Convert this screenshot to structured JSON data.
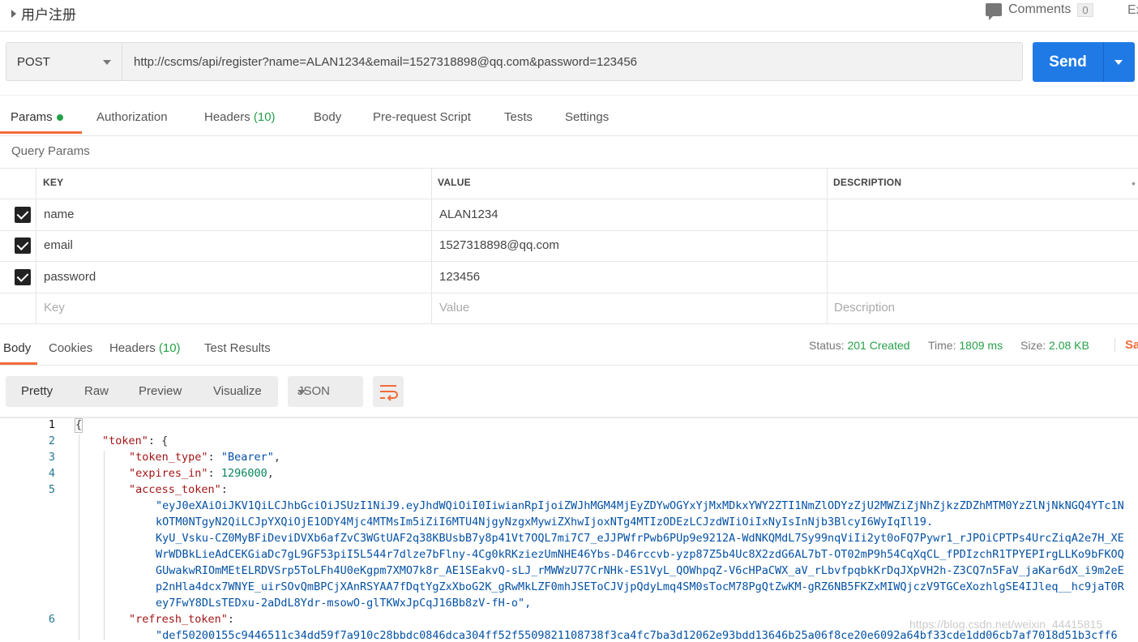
{
  "header": {
    "request_name": "用户注册",
    "comments_label": "Comments",
    "comments_count": "0",
    "extra_label": "Ex"
  },
  "request": {
    "method": "POST",
    "url": "http://cscms/api/register?name=ALAN1234&email=1527318898@qq.com&password=123456",
    "send_label": "Send"
  },
  "request_tabs": [
    {
      "label": "Params"
    },
    {
      "label": "Authorization"
    },
    {
      "label": "Headers",
      "count": "(10)"
    },
    {
      "label": "Body"
    },
    {
      "label": "Pre-request Script"
    },
    {
      "label": "Tests"
    },
    {
      "label": "Settings"
    }
  ],
  "query_params": {
    "title": "Query Params",
    "columns": [
      "KEY",
      "VALUE",
      "DESCRIPTION"
    ],
    "rows": [
      {
        "key": "name",
        "value": "ALAN1234",
        "checked": true
      },
      {
        "key": "email",
        "value": "1527318898@qq.com",
        "checked": true
      },
      {
        "key": "password",
        "value": "123456",
        "checked": true
      }
    ],
    "placeholders": {
      "key": "Key",
      "value": "Value",
      "description": "Description"
    }
  },
  "response_tabs": [
    {
      "label": "Body"
    },
    {
      "label": "Cookies"
    },
    {
      "label": "Headers",
      "count": "(10)"
    },
    {
      "label": "Test Results"
    }
  ],
  "response_status": {
    "status_label": "Status:",
    "status_value": "201 Created",
    "time_label": "Time:",
    "time_value": "1809 ms",
    "size_label": "Size:",
    "size_value": "2.08 KB",
    "save_label": "Save"
  },
  "view_modes": [
    "Pretty",
    "Raw",
    "Preview",
    "Visualize"
  ],
  "format": "JSON",
  "icons": {
    "wrap": "wrap-lines-icon",
    "comments": "comment-icon"
  },
  "colors": {
    "accent": "#f26b3a",
    "send": "#1f7ae6",
    "success": "#26a148"
  },
  "code": {
    "line_numbers": [
      "1",
      "2",
      "3",
      "4",
      "5",
      "6"
    ],
    "brace_open": "{",
    "token_key": "\"token\"",
    "token_type_key": "\"token_type\"",
    "token_type_value": "\"Bearer\"",
    "expires_key": "\"expires_in\"",
    "expires_value": "1296000",
    "access_key": "\"access_token\"",
    "access_lines": [
      "\"eyJ0eXAiOiJKV1QiLCJhbGciOiJSUzI1NiJ9.eyJhdWQiOiI0IiwianRpIjoiZWJhMGM4MjEyZDYwOGYxYjMxMDkxYWY2ZTI1NmZlODYzZjU2MWZiZjNhZjkzZDZhMTM0YzZlNjNkNGQ4YTc1N",
      "kOTM0NTgyN2QiLCJpYXQiOjE1ODY4Mjc4MTMsIm5iZiI6MTU4NjgyNzgxMywiZXhwIjoxNTg4MTIzODEzLCJzdWIiOiIxNyIsInNjb3BlcyI6WyIqIl19.",
      "KyU_Vsku-CZ0MyBFiDeviDVXb6afZvC3WGtUAF2q38KBUsbB7y8p41Vt7OQL7mi7C7_eJJPWfrPwb6PUp9e9212A-WdNKQMdL7Sy99nqViIi2yt0oFQ7Pywr1_rJPOiCPTPs4UrcZiqA2e7H_XE",
      "WrWDBkLieAdCEKGiaDc7gL9GF53piI5L544r7dlze7bFlny-4Cg0kRKziezUmNHE46Ybs-D46rccvb-yzp87Z5b4Uc8X2zdG6AL7bT-OT02mP9h54CqXqCL_fPDIzchR1TPYEPIrgLLKo9bFKOQ",
      "GUwakwRIOmMEtELRDVSrp5ToLFh4U0eKgpm7XMO7k8r_AE1SEakvQ-sLJ_rMWWzU77CrNHk-ES1VyL_QOWhpqZ-V6cHPaCWX_aV_rLbvfpqbkKrDqJXpVH2h-Z3CQ7n5FaV_jaKar6dX_i9m2eE",
      "p2nHla4dcx7WNYE_uirSOvQmBPCjXAnRSYAA7fDqtYgZxXboG2K_gRwMkLZF0mhJSEToCJVjpQdyLmq4SM0sTocM78PgQtZwKM-gRZ6NB5FKZxMIWQjczV9TGCeXozhlgSE4IJleq__hc9jaT0R",
      "ey7FwY8DLsTEDxu-2aDdL8Ydr-msowO-glTKWxJpCqJ16Bb8zV-fH-o\","
    ],
    "refresh_key": "\"refresh_token\"",
    "refresh_line": "\"def50200155c9446511c34dd59f7a910c28bbdc0846dca304ff52f5509821108738f3ca4fc7ba3d12062e93bdd13646b25a06f8ce20e6092a64bf33cde1dd06cb7af7018d51b3cff6"
  },
  "watermark": "https://blog.csdn.net/weixin_44415815"
}
